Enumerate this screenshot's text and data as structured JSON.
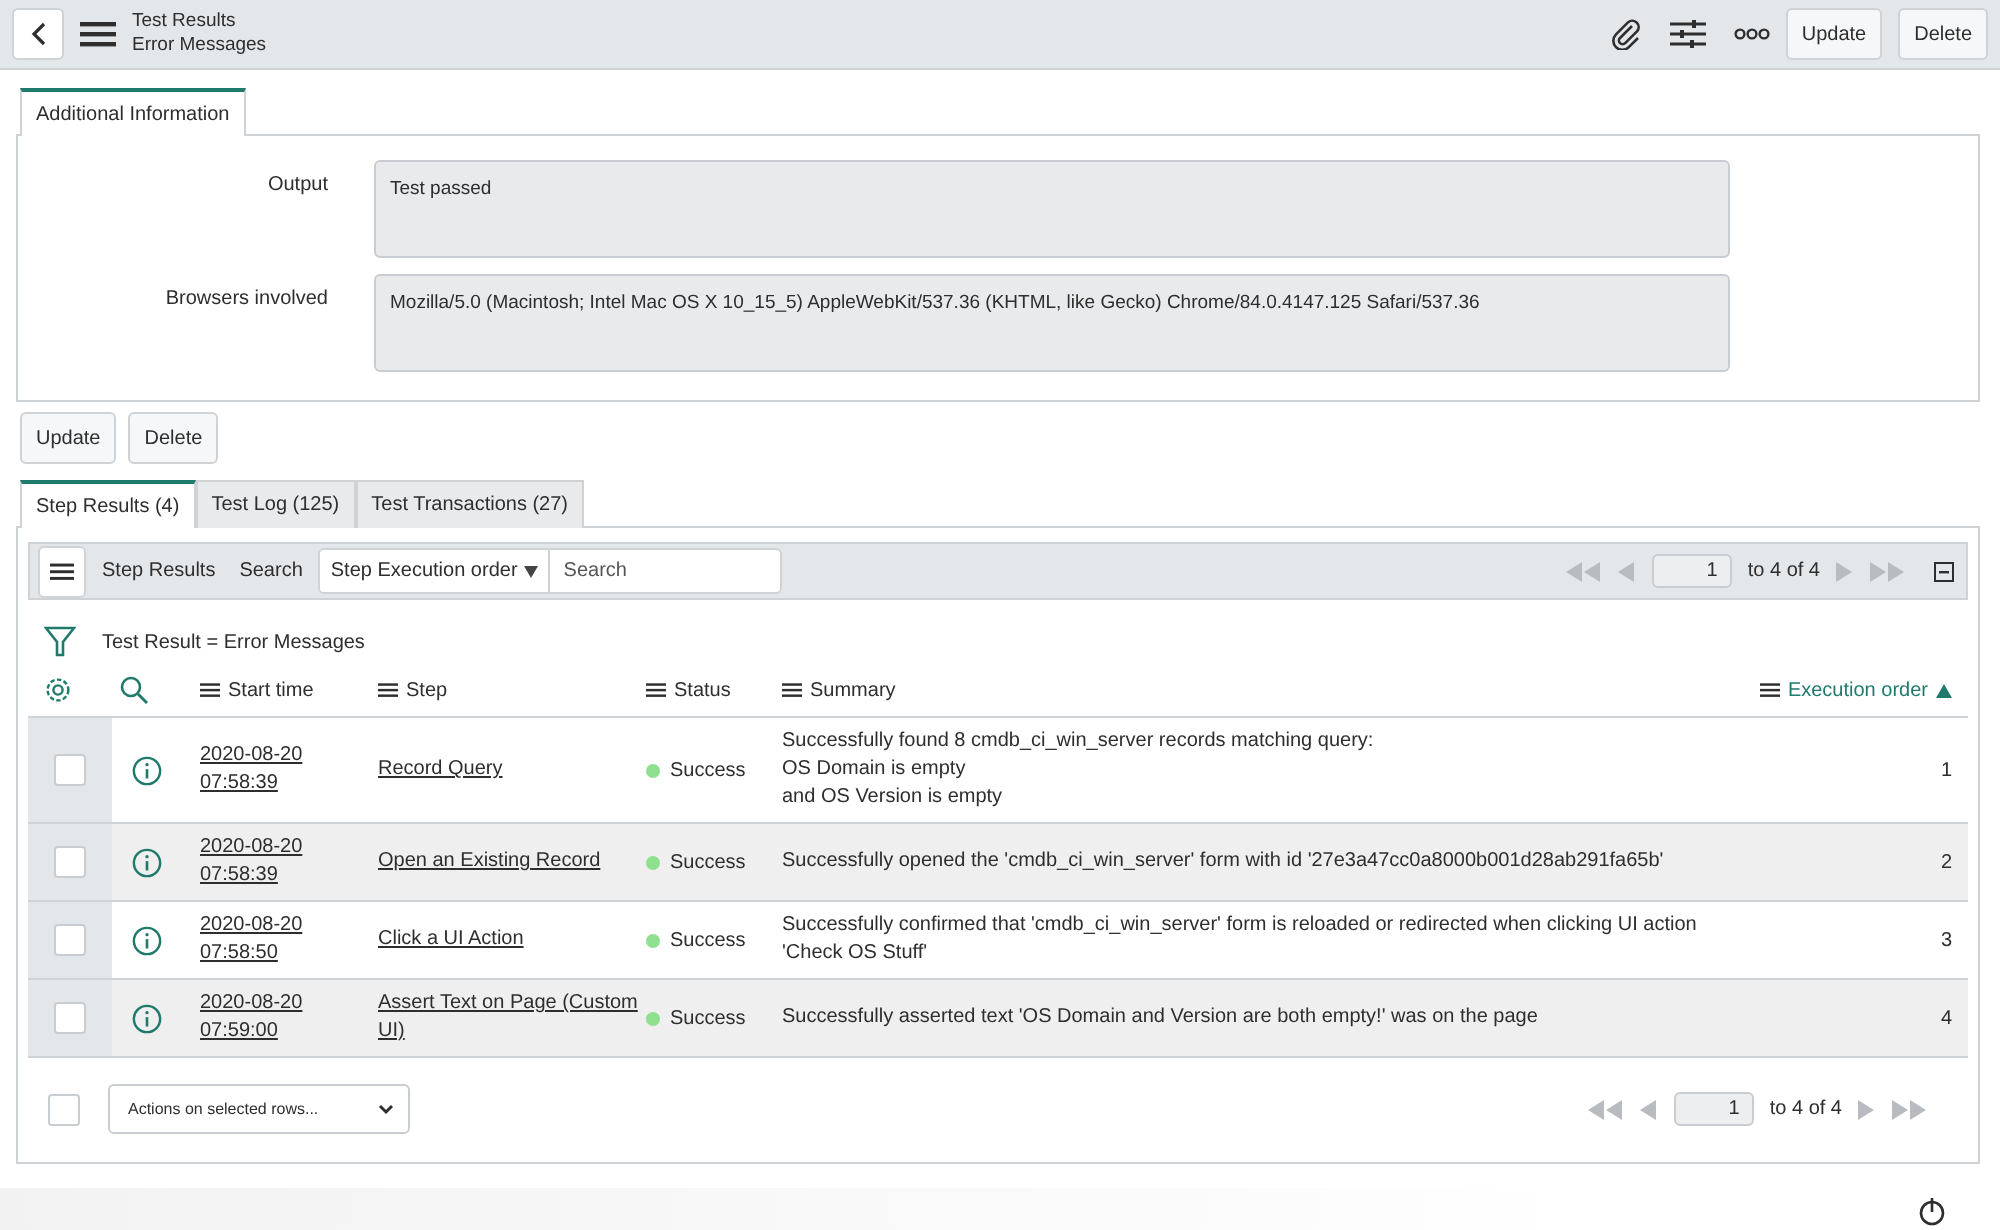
{
  "header": {
    "title": "Test Results",
    "subtitle": "Error Messages",
    "buttons": [
      "Update",
      "Delete"
    ]
  },
  "form": {
    "tabs": [
      {
        "label": "Additional Information",
        "selected": true
      }
    ],
    "fields": [
      {
        "label": "Output",
        "value": "Test passed"
      },
      {
        "label": "Browsers involved",
        "value": "Mozilla/5.0 (Macintosh; Intel Mac OS X 10_15_5) AppleWebKit/537.36 (KHTML, like Gecko) Chrome/84.0.4147.125 Safari/537.36"
      }
    ],
    "buttons": [
      "Update",
      "Delete"
    ]
  },
  "related_tabs": [
    {
      "label": "Step Results (4)",
      "selected": true
    },
    {
      "label": "Test Log (125)",
      "selected": false
    },
    {
      "label": "Test Transactions (27)",
      "selected": false
    }
  ],
  "list": {
    "title": "Step Results",
    "search_label": "Search",
    "search_field": "Step Execution order",
    "search": {
      "placeholder": "Search"
    },
    "page": "1",
    "page_range": "to 4 of 4",
    "filter": "Test Result = Error Messages",
    "columns": [
      {
        "label": "Start time",
        "sorted": false
      },
      {
        "label": "Step",
        "sorted": false
      },
      {
        "label": "Status",
        "sorted": false
      },
      {
        "label": "Summary",
        "sorted": false
      },
      {
        "label": "Execution order",
        "sorted": true
      }
    ],
    "rows": [
      {
        "checked": false,
        "start_date": "2020-08-20",
        "start_time": "07:58:39",
        "step": "Record Query",
        "status": "Success",
        "color": "#8ee08e",
        "summary": "Successfully found 8 cmdb_ci_win_server records matching query:\nOS Domain is empty\nand OS Version is empty",
        "order": "1"
      },
      {
        "checked": false,
        "start_date": "2020-08-20",
        "start_time": "07:58:39",
        "step": "Open an Existing Record",
        "status": "Success",
        "color": "#8ee08e",
        "summary": "Successfully opened the 'cmdb_ci_win_server' form with id '27e3a47cc0a8000b001d28ab291fa65b'",
        "order": "2"
      },
      {
        "checked": false,
        "start_date": "2020-08-20",
        "start_time": "07:58:50",
        "step": "Click a UI Action",
        "status": "Success",
        "color": "#8ee08e",
        "summary": "Successfully confirmed that 'cmdb_ci_win_server' form is reloaded or redirected when clicking UI action 'Check OS Stuff'",
        "order": "3"
      },
      {
        "checked": false,
        "start_date": "2020-08-20",
        "start_time": "07:59:00",
        "step": "Assert Text on Page (Custom UI)",
        "status": "Success",
        "color": "#8ee08e",
        "summary": "Successfully asserted text 'OS Domain and Version are both empty!' was on the page",
        "order": "4"
      }
    ],
    "footer": {
      "checked": false,
      "actions": "Actions on selected rows...",
      "page": "1",
      "page_range": "to 4 of 4"
    }
  }
}
